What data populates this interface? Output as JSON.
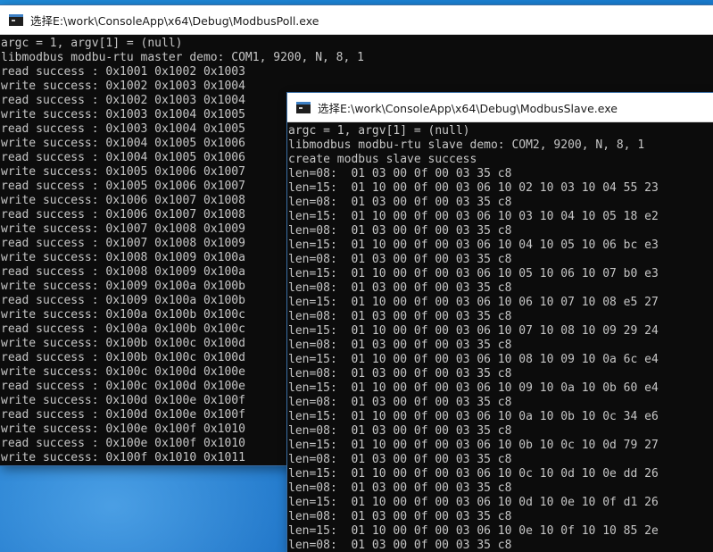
{
  "master_window": {
    "title": "选择E:\\work\\ConsoleApp\\x64\\Debug\\ModbusPoll.exe",
    "icon": "console-app-icon",
    "lines": [
      "argc = 1, argv[1] = (null)",
      "libmodbus modbu-rtu master demo: COM1, 9200, N, 8, 1",
      "read success : 0x1001 0x1002 0x1003",
      "write success: 0x1002 0x1003 0x1004",
      "read success : 0x1002 0x1003 0x1004",
      "write success: 0x1003 0x1004 0x1005",
      "read success : 0x1003 0x1004 0x1005",
      "write success: 0x1004 0x1005 0x1006",
      "read success : 0x1004 0x1005 0x1006",
      "write success: 0x1005 0x1006 0x1007",
      "read success : 0x1005 0x1006 0x1007",
      "write success: 0x1006 0x1007 0x1008",
      "read success : 0x1006 0x1007 0x1008",
      "write success: 0x1007 0x1008 0x1009",
      "read success : 0x1007 0x1008 0x1009",
      "write success: 0x1008 0x1009 0x100a",
      "read success : 0x1008 0x1009 0x100a",
      "write success: 0x1009 0x100a 0x100b",
      "read success : 0x1009 0x100a 0x100b",
      "write success: 0x100a 0x100b 0x100c",
      "read success : 0x100a 0x100b 0x100c",
      "write success: 0x100b 0x100c 0x100d",
      "read success : 0x100b 0x100c 0x100d",
      "write success: 0x100c 0x100d 0x100e",
      "read success : 0x100c 0x100d 0x100e",
      "write success: 0x100d 0x100e 0x100f",
      "read success : 0x100d 0x100e 0x100f",
      "write success: 0x100e 0x100f 0x1010",
      "read success : 0x100e 0x100f 0x1010",
      "write success: 0x100f 0x1010 0x1011"
    ]
  },
  "slave_window": {
    "title": "选择E:\\work\\ConsoleApp\\x64\\Debug\\ModbusSlave.exe",
    "icon": "console-app-icon",
    "lines": [
      "argc = 1, argv[1] = (null)",
      "libmodbus modbu-rtu slave demo: COM2, 9200, N, 8, 1",
      "create modbus slave success",
      "len=08:  01 03 00 0f 00 03 35 c8",
      "len=15:  01 10 00 0f 00 03 06 10 02 10 03 10 04 55 23",
      "len=08:  01 03 00 0f 00 03 35 c8",
      "len=15:  01 10 00 0f 00 03 06 10 03 10 04 10 05 18 e2",
      "len=08:  01 03 00 0f 00 03 35 c8",
      "len=15:  01 10 00 0f 00 03 06 10 04 10 05 10 06 bc e3",
      "len=08:  01 03 00 0f 00 03 35 c8",
      "len=15:  01 10 00 0f 00 03 06 10 05 10 06 10 07 b0 e3",
      "len=08:  01 03 00 0f 00 03 35 c8",
      "len=15:  01 10 00 0f 00 03 06 10 06 10 07 10 08 e5 27",
      "len=08:  01 03 00 0f 00 03 35 c8",
      "len=15:  01 10 00 0f 00 03 06 10 07 10 08 10 09 29 24",
      "len=08:  01 03 00 0f 00 03 35 c8",
      "len=15:  01 10 00 0f 00 03 06 10 08 10 09 10 0a 6c e4",
      "len=08:  01 03 00 0f 00 03 35 c8",
      "len=15:  01 10 00 0f 00 03 06 10 09 10 0a 10 0b 60 e4",
      "len=08:  01 03 00 0f 00 03 35 c8",
      "len=15:  01 10 00 0f 00 03 06 10 0a 10 0b 10 0c 34 e6",
      "len=08:  01 03 00 0f 00 03 35 c8",
      "len=15:  01 10 00 0f 00 03 06 10 0b 10 0c 10 0d 79 27",
      "len=08:  01 03 00 0f 00 03 35 c8",
      "len=15:  01 10 00 0f 00 03 06 10 0c 10 0d 10 0e dd 26",
      "len=08:  01 03 00 0f 00 03 35 c8",
      "len=15:  01 10 00 0f 00 03 06 10 0d 10 0e 10 0f d1 26",
      "len=08:  01 03 00 0f 00 03 35 c8",
      "len=15:  01 10 00 0f 00 03 06 10 0e 10 0f 10 10 85 2e",
      "len=08:  01 03 00 0f 00 03 35 c8"
    ]
  },
  "colors": {
    "console_bg": "#0c0c0c",
    "console_text": "#c6c6c6",
    "desktop_bg": "#1676cc"
  }
}
